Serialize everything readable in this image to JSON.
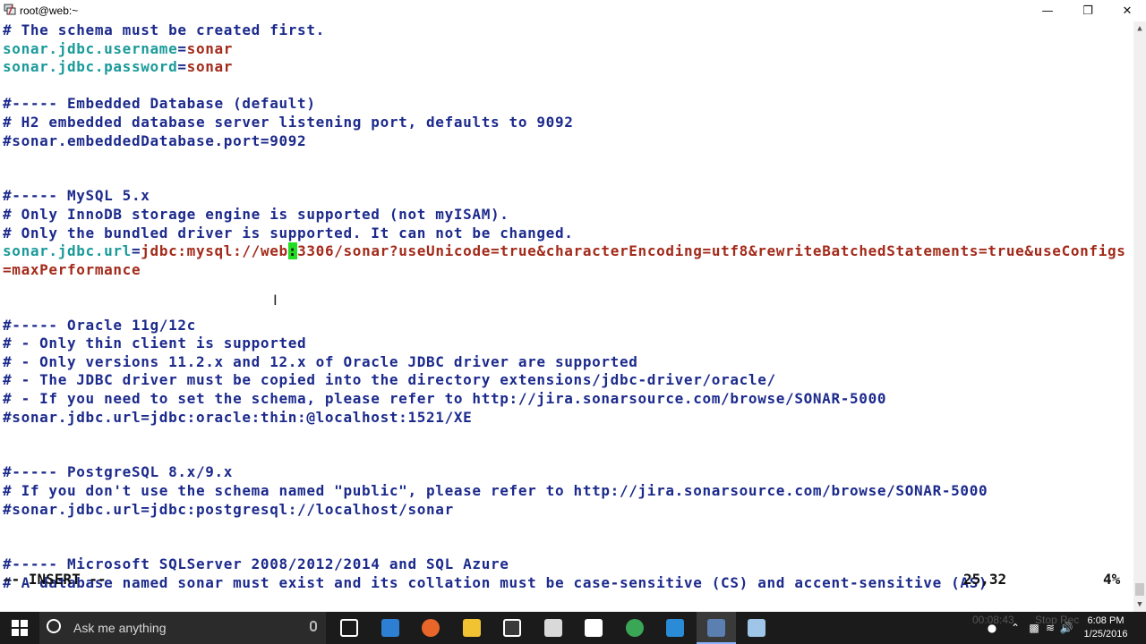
{
  "window": {
    "title": "root@web:~"
  },
  "lines": [
    [
      {
        "t": "# The schema must be created first.",
        "c": "com"
      }
    ],
    [
      {
        "t": "sonar.jdbc.username",
        "c": "key"
      },
      {
        "t": "=",
        "c": "op"
      },
      {
        "t": "sonar",
        "c": "val"
      }
    ],
    [
      {
        "t": "sonar.jdbc.password",
        "c": "key"
      },
      {
        "t": "=",
        "c": "op"
      },
      {
        "t": "sonar",
        "c": "val"
      }
    ],
    [
      {
        "t": "",
        "c": "com"
      }
    ],
    [
      {
        "t": "#----- Embedded Database (default)",
        "c": "com"
      }
    ],
    [
      {
        "t": "# H2 embedded database server listening port, defaults to 9092",
        "c": "com"
      }
    ],
    [
      {
        "t": "#sonar.embeddedDatabase.port=9092",
        "c": "com"
      }
    ],
    [
      {
        "t": "",
        "c": "com"
      }
    ],
    [
      {
        "t": "",
        "c": "com"
      }
    ],
    [
      {
        "t": "#----- MySQL 5.x",
        "c": "com"
      }
    ],
    [
      {
        "t": "# Only InnoDB storage engine is supported (not myISAM).",
        "c": "com"
      }
    ],
    [
      {
        "t": "# Only the bundled driver is supported. It can not be changed.",
        "c": "com"
      }
    ],
    [
      {
        "t": "sonar.jdbc.url",
        "c": "key"
      },
      {
        "t": "=",
        "c": "op"
      },
      {
        "t": "jdbc:mysql://web",
        "c": "val"
      },
      {
        "t": ":",
        "c": "cur"
      },
      {
        "t": "3306/sonar?useUnicode=true&characterEncoding=utf8&rewriteBatchedStatements=true&useConfigs",
        "c": "val"
      }
    ],
    [
      {
        "t": "=maxPerformance",
        "c": "val"
      }
    ],
    [
      {
        "t": "",
        "c": "com"
      }
    ],
    [
      {
        "t": "",
        "c": "com"
      }
    ],
    [
      {
        "t": "#----- Oracle 11g/12c",
        "c": "com"
      }
    ],
    [
      {
        "t": "# - Only thin client is supported",
        "c": "com"
      }
    ],
    [
      {
        "t": "# - Only versions 11.2.x and 12.x of Oracle JDBC driver are supported",
        "c": "com"
      }
    ],
    [
      {
        "t": "# - The JDBC driver must be copied into the directory extensions/jdbc-driver/oracle/",
        "c": "com"
      }
    ],
    [
      {
        "t": "# - If you need to set the schema, please refer to http://jira.sonarsource.com/browse/SONAR-5000",
        "c": "com"
      }
    ],
    [
      {
        "t": "#sonar.jdbc.url=jdbc:oracle:thin:@localhost:1521/XE",
        "c": "com"
      }
    ],
    [
      {
        "t": "",
        "c": "com"
      }
    ],
    [
      {
        "t": "",
        "c": "com"
      }
    ],
    [
      {
        "t": "#----- PostgreSQL 8.x/9.x",
        "c": "com"
      }
    ],
    [
      {
        "t": "# If you don't use the schema named \"public\", please refer to http://jira.sonarsource.com/browse/SONAR-5000",
        "c": "com"
      }
    ],
    [
      {
        "t": "#sonar.jdbc.url=jdbc:postgresql://localhost/sonar",
        "c": "com"
      }
    ],
    [
      {
        "t": "",
        "c": "com"
      }
    ],
    [
      {
        "t": "",
        "c": "com"
      }
    ],
    [
      {
        "t": "#----- Microsoft SQLServer 2008/2012/2014 and SQL Azure",
        "c": "com"
      }
    ],
    [
      {
        "t": "# A database named sonar must exist and its collation must be case-sensitive (CS) and accent-sensitive (AS)",
        "c": "com"
      }
    ]
  ],
  "status": {
    "mode": "-- INSERT --",
    "position": "25,32",
    "percent": "4%"
  },
  "taskbar": {
    "search_placeholder": "Ask me anything",
    "clock_time": "6:08 PM",
    "clock_date": "1/25/2016",
    "ghost_time": "00:08:43",
    "ghost_label": "Stop Rec",
    "apps": [
      {
        "name": "task-view",
        "color": "#1b1b1b",
        "border": "#ffffff"
      },
      {
        "name": "edge",
        "color": "#2d7fd3",
        "border": ""
      },
      {
        "name": "firefox",
        "color": "#e8662a",
        "border": ""
      },
      {
        "name": "file-explorer",
        "color": "#f1c232",
        "border": ""
      },
      {
        "name": "store",
        "color": "#3a3a3a",
        "border": "#ffffff"
      },
      {
        "name": "media",
        "color": "#d9d9d9",
        "border": ""
      },
      {
        "name": "app-s",
        "color": "#ffffff",
        "border": ""
      },
      {
        "name": "chrome",
        "color": "#3aa757",
        "border": ""
      },
      {
        "name": "mail",
        "color": "#2a8bd6",
        "border": ""
      },
      {
        "name": "putty",
        "color": "#5b7fb0",
        "border": ""
      },
      {
        "name": "notepad",
        "color": "#9fc5e8",
        "border": ""
      }
    ]
  }
}
